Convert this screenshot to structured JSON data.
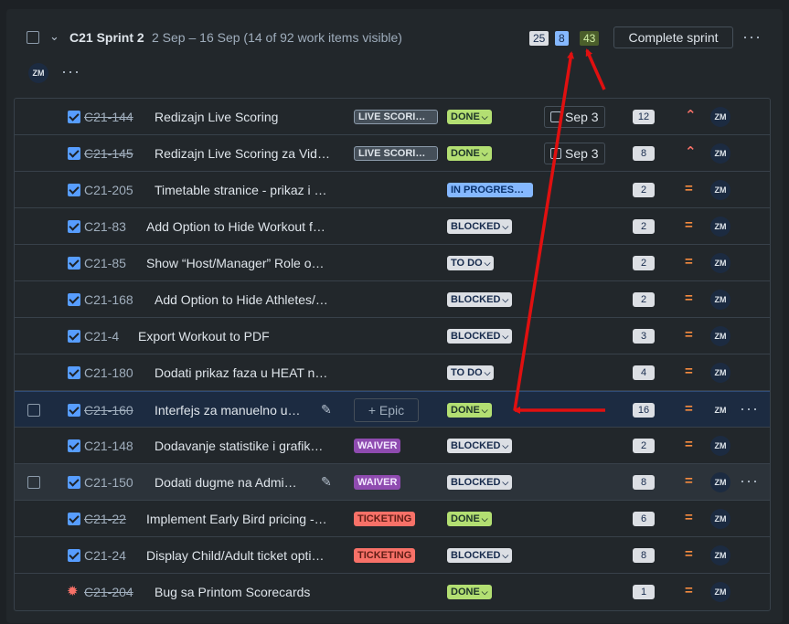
{
  "sprint": {
    "name": "C21 Sprint 2",
    "meta": "2 Sep – 16 Sep (14 of 92 work items visible)",
    "counts": {
      "todo": "25",
      "in_progress": "8",
      "done": "43"
    },
    "complete_label": "Complete sprint",
    "assignee_initials": "ZM"
  },
  "rows": [
    {
      "key": "C21-144",
      "summary": "Redizajn Live Scoring",
      "label": "LIVE SCORI…",
      "status": "DONE",
      "due": "Sep 3",
      "points": "12",
      "priority": "high",
      "avatar": "ZM"
    },
    {
      "key": "C21-145",
      "summary": "Redizajn Live Scoring za Vid…",
      "label": "LIVE SCORI…",
      "status": "DONE",
      "due": "Sep 3",
      "points": "8",
      "priority": "high",
      "avatar": "ZM"
    },
    {
      "key": "C21-205",
      "summary": "Timetable stranice - prikaz i …",
      "status": "IN PROGRES…",
      "points": "2",
      "priority": "medium",
      "avatar": "ZM"
    },
    {
      "key": "C21-83",
      "summary": "Add Option to Hide Workout f…",
      "status": "BLOCKED",
      "points": "2",
      "priority": "medium",
      "avatar": "ZM"
    },
    {
      "key": "C21-85",
      "summary": "Show “Host/Manager” Role o…",
      "status": "TO DO",
      "points": "2",
      "priority": "medium",
      "avatar": "ZM"
    },
    {
      "key": "C21-168",
      "summary": "Add Option to Hide Athletes/…",
      "status": "BLOCKED",
      "points": "2",
      "priority": "medium",
      "avatar": "ZM"
    },
    {
      "key": "C21-4",
      "summary": "Export Workout to PDF",
      "status": "BLOCKED",
      "points": "3",
      "priority": "medium",
      "avatar": "ZM"
    },
    {
      "key": "C21-180",
      "summary": "Dodati prikaz faza u HEAT n…",
      "status": "TO DO",
      "points": "4",
      "priority": "medium",
      "avatar": "ZM"
    },
    {
      "key": "C21-160",
      "summary": "Interfejs za manuelno u…",
      "epic_label": "+ Epic",
      "status": "DONE",
      "points": "16",
      "priority": "medium",
      "avatar": "ZM"
    },
    {
      "key": "C21-148",
      "summary": "Dodavanje statistike i grafik…",
      "label": "WAIVER",
      "status": "BLOCKED",
      "points": "2",
      "priority": "medium",
      "avatar": "ZM"
    },
    {
      "key": "C21-150",
      "summary": "Dodati dugme na Admi…",
      "label": "WAIVER",
      "status": "BLOCKED",
      "points": "8",
      "priority": "medium",
      "avatar": "ZM"
    },
    {
      "key": "C21-22",
      "summary": "Implement Early Bird pricing -…",
      "label": "TICKETING",
      "status": "DONE",
      "points": "6",
      "priority": "medium",
      "avatar": "ZM"
    },
    {
      "key": "C21-24",
      "summary": "Display Child/Adult ticket opti…",
      "label": "TICKETING",
      "status": "BLOCKED",
      "points": "8",
      "priority": "medium",
      "avatar": "ZM"
    },
    {
      "key": "C21-204",
      "summary": "Bug sa Printom Scorecards",
      "status": "DONE",
      "points": "1",
      "priority": "medium",
      "avatar": "ZM"
    }
  ],
  "colors": {
    "arrow": "#e01010",
    "done": "#b3df72",
    "in_progress": "#85b8ff"
  }
}
